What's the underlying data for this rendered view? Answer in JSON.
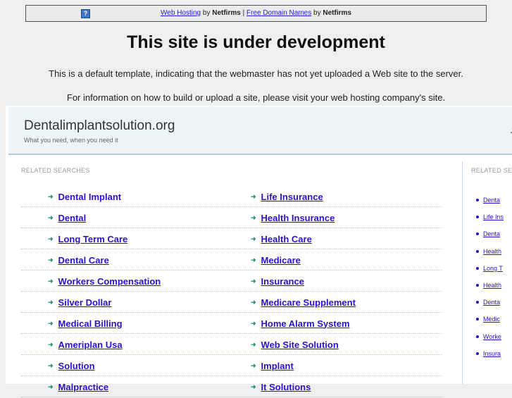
{
  "topbar": {
    "icon": "question-icon",
    "link1": "Web Hosting",
    "by1": "by",
    "brand1": "Netfirms",
    "sep": "|",
    "link2": "Free Domain Names",
    "by2": "by",
    "brand2": "Netfirms"
  },
  "heading": "This site is under development",
  "para1": "This is a default template, indicating that the webmaster has not yet uploaded a Web site to the server.",
  "para2": "For information on how to build or upload a site, please visit your web hosting company's site.",
  "site": {
    "name": "Dentalimplantsolution.org",
    "tagline": "What you need, when you need it",
    "header_right": "J",
    "related_label": "RELATED SEARCHES",
    "right_label": "RELATED SEA",
    "rows": [
      [
        "Dental Implant",
        "Life Insurance"
      ],
      [
        "Dental",
        "Health Insurance"
      ],
      [
        "Long Term Care",
        "Health Care"
      ],
      [
        "Dental Care",
        "Medicare"
      ],
      [
        "Workers Compensation",
        "Insurance"
      ],
      [
        "Silver Dollar",
        "Medicare Supplement"
      ],
      [
        "Medical Billing",
        "Home Alarm System"
      ],
      [
        "Ameriplan Usa",
        "Web Site Solution"
      ],
      [
        "Solution",
        "Implant"
      ],
      [
        "Malpractice",
        "It Solutions"
      ]
    ],
    "right_items": [
      "Denta",
      "Life Ins",
      "Denta",
      "Health",
      "Long T",
      "Health",
      "Denta",
      "Medic",
      "Worke",
      "Insura"
    ]
  }
}
